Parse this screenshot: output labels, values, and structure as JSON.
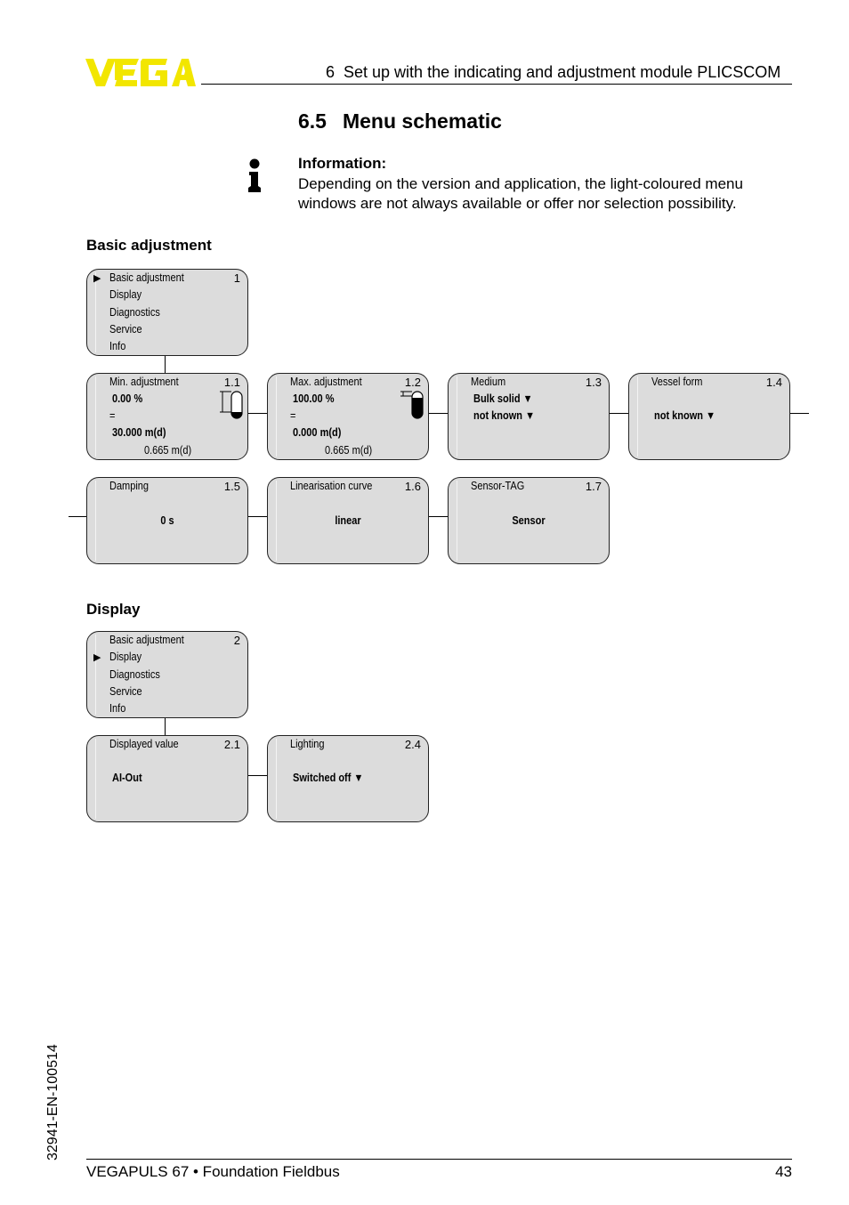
{
  "header": {
    "brand": "VEGA",
    "brand_color": "#f2e600",
    "chapter_number": "6",
    "chapter_title": "Set up with the indicating and adjustment module PLICSCOM"
  },
  "section": {
    "number": "6.5",
    "title": "Menu schematic"
  },
  "info": {
    "icon": "info-icon",
    "heading": "Information:",
    "text": "Depending on the version and application, the light-coloured menu windows are not always available or offer nor selection possibility."
  },
  "basic_adjustment": {
    "heading": "Basic adjustment",
    "main_menu": {
      "number": "1",
      "selected_index": 0,
      "items": [
        "Basic adjustment",
        "Display",
        "Diagnostics",
        "Service",
        "Info"
      ]
    },
    "windows": [
      {
        "title": "Min. adjustment",
        "number": "1.1",
        "percent": "0.00 %",
        "equals": "=",
        "distance": "30.000 m(d)",
        "measured": "0.665 m(d)",
        "gauge_fill": 0.0
      },
      {
        "title": "Max. adjustment",
        "number": "1.2",
        "percent": "100.00 %",
        "equals": "=",
        "distance": "0.000 m(d)",
        "measured": "0.665 m(d)",
        "gauge_fill": 1.0
      },
      {
        "title": "Medium",
        "number": "1.3",
        "value1": "Bulk solid",
        "value2": "not known"
      },
      {
        "title": "Vessel form",
        "number": "1.4",
        "value": "not known"
      },
      {
        "title": "Damping",
        "number": "1.5",
        "value": "0 s"
      },
      {
        "title": "Linearisation curve",
        "number": "1.6",
        "value": "linear"
      },
      {
        "title": "Sensor-TAG",
        "number": "1.7",
        "value": "Sensor"
      }
    ]
  },
  "display": {
    "heading": "Display",
    "main_menu": {
      "number": "2",
      "selected_index": 1,
      "items": [
        "Basic adjustment",
        "Display",
        "Diagnostics",
        "Service",
        "Info"
      ]
    },
    "windows": [
      {
        "title": "Displayed value",
        "number": "2.1",
        "value": "AI-Out"
      },
      {
        "title": "Lighting",
        "number": "2.4",
        "value": "Switched off"
      }
    ]
  },
  "glyphs": {
    "pointer": "▶",
    "dropdown": "▼"
  },
  "side_code": "32941-EN-100514",
  "footer": {
    "product": "VEGAPULS 67 • Foundation Fieldbus",
    "page_number": "43"
  }
}
